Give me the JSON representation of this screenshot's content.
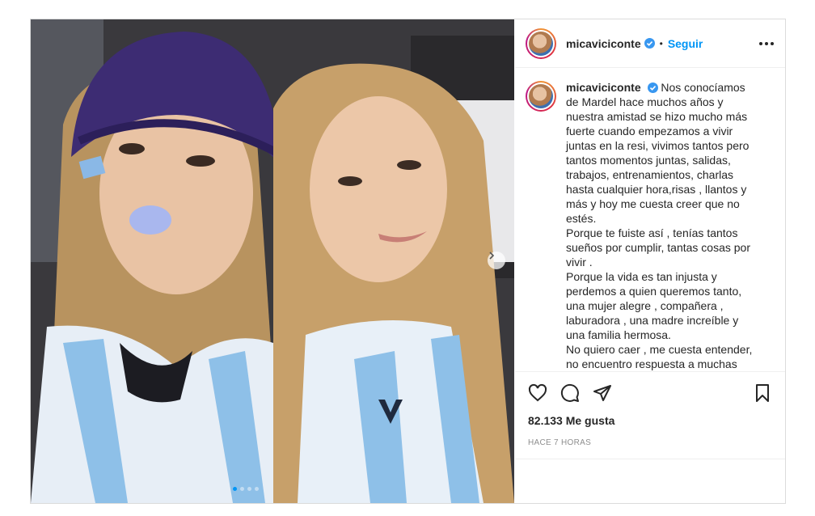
{
  "post": {
    "username": "micaviciconte",
    "follow_label": "Seguir",
    "separator": "•",
    "caption": "Nos conocíamos de Mardel hace muchos años y nuestra amistad se hizo mucho más fuerte cuando empezamos a vivir juntas en la resi, vivimos tantos pero tantos momentos juntas, salidas, trabajos, entrenamientos, charlas hasta cualquier hora,risas , llantos y más y hoy me cuesta creer que no estés.\nPorque te fuiste así , tenías tantos sueños por cumplir, tantas cosas por vivir .\nPorque la vida es tan injusta y perdemos a quien queremos tanto, una mujer alegre , compañera , laburadora , una madre increíble y una familia hermosa.\nNo quiero caer , me cuesta entender, no encuentro respuesta a muchas preguntas que me hago todo el",
    "likes": "82.133 Me gusta",
    "time": "HACE 7 HORAS",
    "photo_alt": "",
    "carousel_count": 4,
    "carousel_active": 0
  },
  "icons": {
    "verified": "verified-badge-icon",
    "more": "more-options-icon",
    "like": "heart-icon",
    "comment": "comment-icon",
    "share": "send-icon",
    "save": "bookmark-icon",
    "next": "chevron-right-icon"
  },
  "colors": {
    "accent": "#0095f6",
    "text": "#262626",
    "muted": "#8e8e8e",
    "border": "#dbdbdb"
  }
}
